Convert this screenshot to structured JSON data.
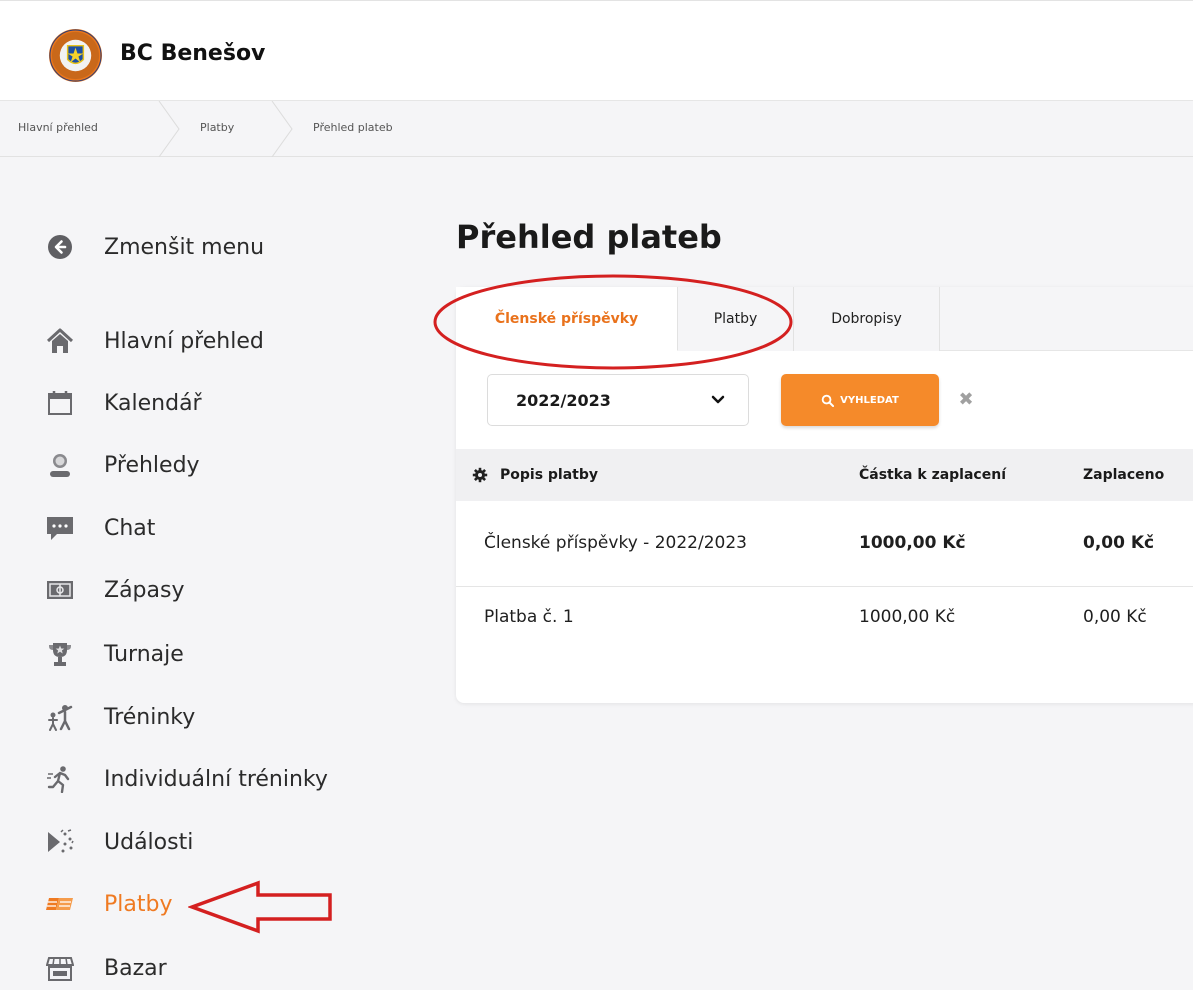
{
  "app": {
    "brand": "BC Benešov",
    "logo_text": "BASKETBALL CLUB BENEŠOV"
  },
  "breadcrumb": [
    "Hlavní přehled",
    "Platby",
    "Přehled plateb"
  ],
  "sidebar": {
    "collapse_label": "Zmenšit menu",
    "items": [
      {
        "label": "Hlavní přehled",
        "icon": "home-icon"
      },
      {
        "label": "Kalendář",
        "icon": "calendar-icon"
      },
      {
        "label": "Přehledy",
        "icon": "person-icon"
      },
      {
        "label": "Chat",
        "icon": "chat-icon"
      },
      {
        "label": "Zápasy",
        "icon": "field-icon"
      },
      {
        "label": "Turnaje",
        "icon": "trophy-icon"
      },
      {
        "label": "Tréninky",
        "icon": "training-icon"
      },
      {
        "label": "Individuální tréninky",
        "icon": "runner-icon"
      },
      {
        "label": "Události",
        "icon": "event-icon"
      },
      {
        "label": "Platby",
        "icon": "money-icon",
        "active": true
      },
      {
        "label": "Bazar",
        "icon": "shop-icon"
      }
    ]
  },
  "main": {
    "title": "Přehled plateb",
    "tabs": [
      {
        "label": "Členské příspěvky",
        "active": true
      },
      {
        "label": "Platby"
      },
      {
        "label": "Dobropisy"
      }
    ],
    "filter": {
      "season_value": "2022/2023",
      "search_label": "VYHLEDAT",
      "clear_symbol": "✖"
    },
    "table": {
      "headers": [
        "Popis platby",
        "Částka k zaplacení",
        "Zaplaceno"
      ],
      "rows": [
        {
          "cells": [
            "Členské příspěvky - 2022/2023",
            "1000,00 Kč",
            "0,00 Kč"
          ],
          "bold": true
        },
        {
          "cells": [
            "Platba č. 1",
            "1000,00 Kč",
            "0,00 Kč"
          ],
          "bold": false
        }
      ]
    }
  },
  "colors": {
    "accent": "#ef7a22",
    "annotation": "#d42020"
  }
}
